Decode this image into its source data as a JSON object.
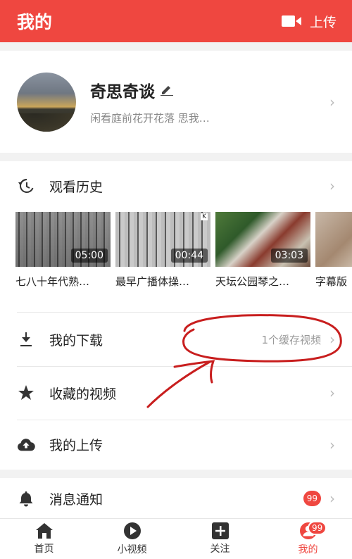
{
  "header": {
    "title": "我的",
    "upload_label": "上传"
  },
  "profile": {
    "name": "奇思奇谈",
    "signature": "闲看庭前花开花落 思我…"
  },
  "history": {
    "label": "观看历史",
    "videos": [
      {
        "duration": "05:00",
        "caption": "七八十年代熟…"
      },
      {
        "duration": "00:44",
        "caption": "最早广播体操…"
      },
      {
        "duration": "03:03",
        "caption": "天坛公园琴之…"
      },
      {
        "duration": "",
        "caption": "字幕版"
      }
    ]
  },
  "menu": {
    "download_label": "我的下载",
    "download_extra": "1个缓存视频",
    "favorites_label": "收藏的视频",
    "uploads_label": "我的上传",
    "notifications_label": "消息通知",
    "notifications_badge": "99"
  },
  "bottom_nav": {
    "items": [
      {
        "label": "首页",
        "icon": "home-icon"
      },
      {
        "label": "小视频",
        "icon": "play-circle-icon"
      },
      {
        "label": "关注",
        "icon": "plus-square-icon"
      },
      {
        "label": "我的",
        "icon": "user-icon",
        "badge": "99",
        "active": true
      }
    ]
  },
  "colors": {
    "accent": "#ef4740",
    "annotation": "#c81e1e"
  }
}
